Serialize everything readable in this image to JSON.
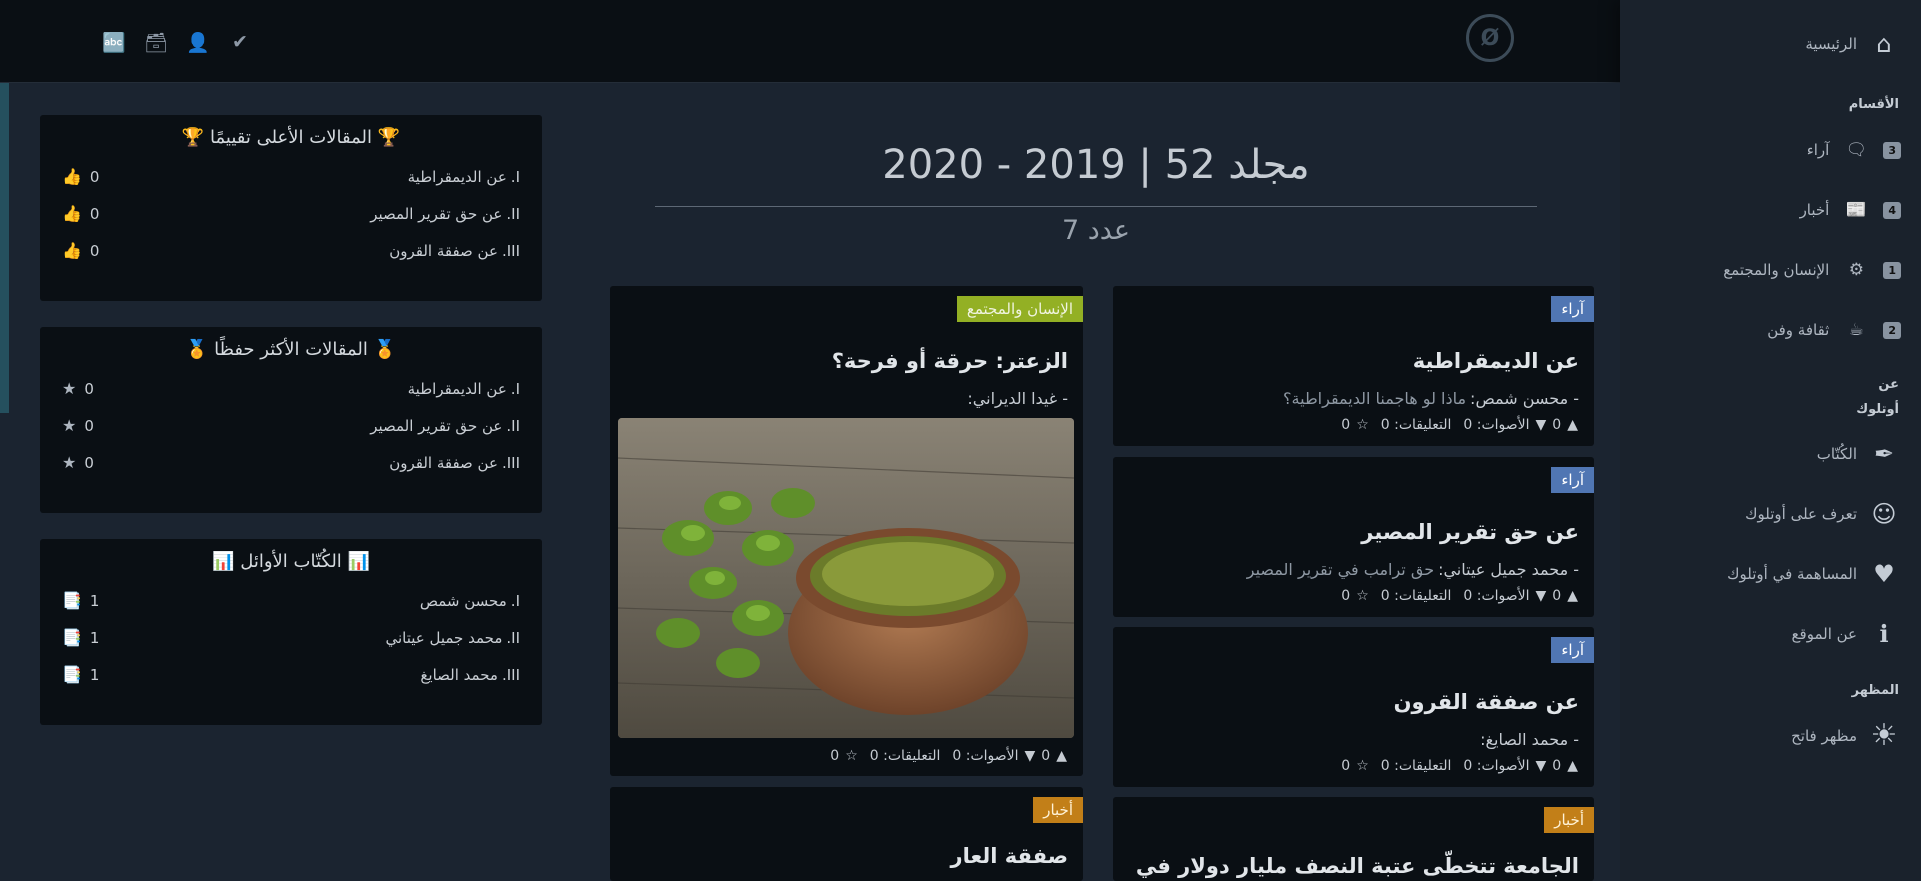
{
  "topbar": {
    "icons": [
      "translate-icon",
      "archive-icon",
      "add-user-icon",
      "user-check-icon"
    ],
    "logo_glyph": "Ø"
  },
  "sidebar": {
    "home": "الرئيسية",
    "sections_header": "الأقسام",
    "sections": [
      {
        "label": "آراء",
        "count": "3",
        "icon": "chat-icon"
      },
      {
        "label": "أخبار",
        "count": "4",
        "icon": "newspaper-icon"
      },
      {
        "label": "الإنسان والمجتمع",
        "count": "1",
        "icon": "network-icon"
      },
      {
        "label": "ثقافة وفن",
        "count": "2",
        "icon": "coffee-icon"
      }
    ],
    "about_header_1": "عن",
    "about_header_2": "أوتلوك",
    "about": [
      {
        "label": "الكُتّاب",
        "icon": "feather-icon"
      },
      {
        "label": "تعرف على أوتلوك",
        "icon": "team-icon"
      },
      {
        "label": "المساهمة في أوتلوك",
        "icon": "hand-heart-icon"
      },
      {
        "label": "عن الموقع",
        "icon": "info-icon"
      }
    ],
    "appearance_header": "المظهر",
    "theme_label": "مظهر فاتح"
  },
  "header": {
    "volume": "مجلد 52  |  2019 - 2020",
    "issue": "عدد 7"
  },
  "widgets": {
    "top_rated": {
      "title": "المقالات الأعلى تقييمًا",
      "items": [
        {
          "rank": "I.",
          "label": "عن الديمقراطية",
          "count": "0"
        },
        {
          "rank": "II.",
          "label": "عن حق تقرير المصير",
          "count": "0"
        },
        {
          "rank": "III.",
          "label": "عن صفقة القرون",
          "count": "0"
        }
      ]
    },
    "most_saved": {
      "title": "المقالات الأكثر حفظًا",
      "items": [
        {
          "rank": "I.",
          "label": "عن الديمقراطية",
          "count": "0"
        },
        {
          "rank": "II.",
          "label": "عن حق تقرير المصير",
          "count": "0"
        },
        {
          "rank": "III.",
          "label": "عن صفقة القرون",
          "count": "0"
        }
      ]
    },
    "top_writers": {
      "title": "الكُتّاب الأوائل",
      "items": [
        {
          "rank": "I.",
          "label": "محسن شمص",
          "count": "1"
        },
        {
          "rank": "II.",
          "label": "محمد جميل عيتاني",
          "count": "1"
        },
        {
          "rank": "III.",
          "label": "محمد الصايغ",
          "count": "1"
        }
      ]
    }
  },
  "articles": [
    {
      "tag": "آراء",
      "title": "عن الديمقراطية",
      "author": "- محسن شمص:",
      "subtitle": "ماذا لو هاجمنا الديمقراطية؟",
      "votes": "0",
      "votes_label": "الأصوات: 0",
      "comments_label": "التعليقات: 0",
      "stars": "0"
    },
    {
      "tag": "آراء",
      "title": "عن حق تقرير المصير",
      "author": "- محمد جميل عيتاني:",
      "subtitle": "حق ترامب في تقرير المصير",
      "votes": "0",
      "votes_label": "الأصوات: 0",
      "comments_label": "التعليقات: 0",
      "stars": "0"
    },
    {
      "tag": "آراء",
      "title": "عن صفقة القرون",
      "author": "- محمد الصايغ:",
      "subtitle": "",
      "votes": "0",
      "votes_label": "الأصوات: 0",
      "comments_label": "التعليقات: 0",
      "stars": "0"
    },
    {
      "tag": "أخبار",
      "title": "الجامعة تتخطّى عتبة النصف مليار دولار في"
    },
    {
      "tag": "الإنسان والمجتمع",
      "title": "الزعتر: حرقة أو فرحة؟",
      "author": "- غيدا الديراني:",
      "votes": "0",
      "votes_label": "الأصوات: 0",
      "comments_label": "التعليقات: 0",
      "stars": "0"
    },
    {
      "tag": "أخبار",
      "title": "صفقة العار"
    }
  ],
  "colors": {
    "opinion": "#5076b3",
    "society": "#93b024",
    "news": "#c27f18"
  }
}
